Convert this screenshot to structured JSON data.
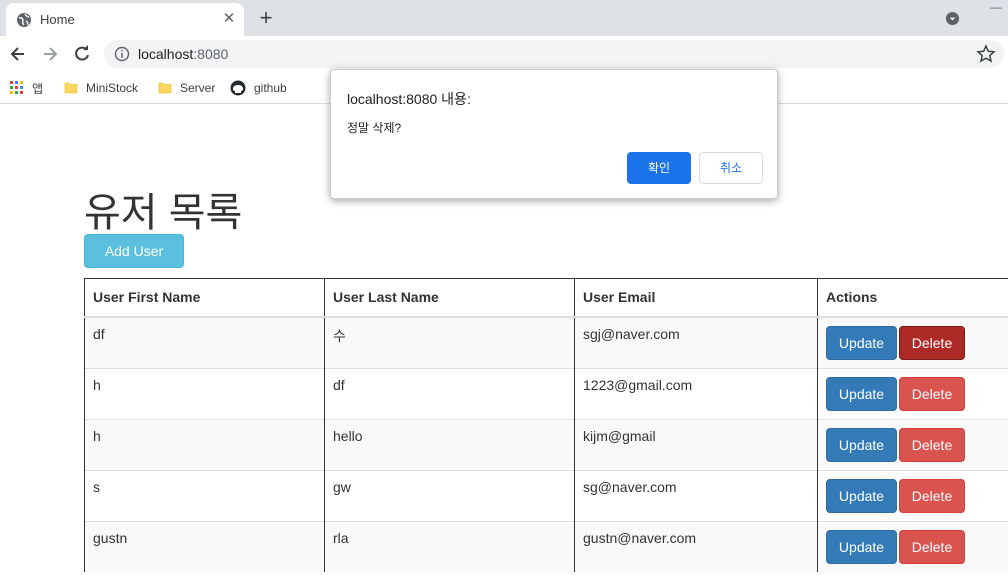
{
  "browser": {
    "tab_title": "Home",
    "url_host": "localhost",
    "url_port": ":8080",
    "bookmarks": [
      {
        "label": "앱",
        "icon": "apps-grid-icon"
      },
      {
        "label": "MiniStock",
        "icon": "folder-icon"
      },
      {
        "label": "Server",
        "icon": "folder-icon"
      },
      {
        "label": "github",
        "icon": "github-icon"
      }
    ]
  },
  "page": {
    "title": "유저 목록",
    "add_button": "Add User",
    "columns": [
      "User First Name",
      "User Last Name",
      "User Email",
      "Actions"
    ],
    "rows": [
      {
        "first": "df",
        "last": "수",
        "email": "sgj@naver.com"
      },
      {
        "first": "h",
        "last": "df",
        "email": "1223@gmail.com"
      },
      {
        "first": "h",
        "last": "hello",
        "email": "kijm@gmail"
      },
      {
        "first": "s",
        "last": "gw",
        "email": "sg@naver.com"
      },
      {
        "first": "gustn",
        "last": "rla",
        "email": "gustn@naver.com"
      }
    ],
    "update_label": "Update",
    "delete_label": "Delete"
  },
  "dialog": {
    "title": "localhost:8080 내용:",
    "message": "정말 삭제?",
    "ok_label": "확인",
    "cancel_label": "취소"
  }
}
